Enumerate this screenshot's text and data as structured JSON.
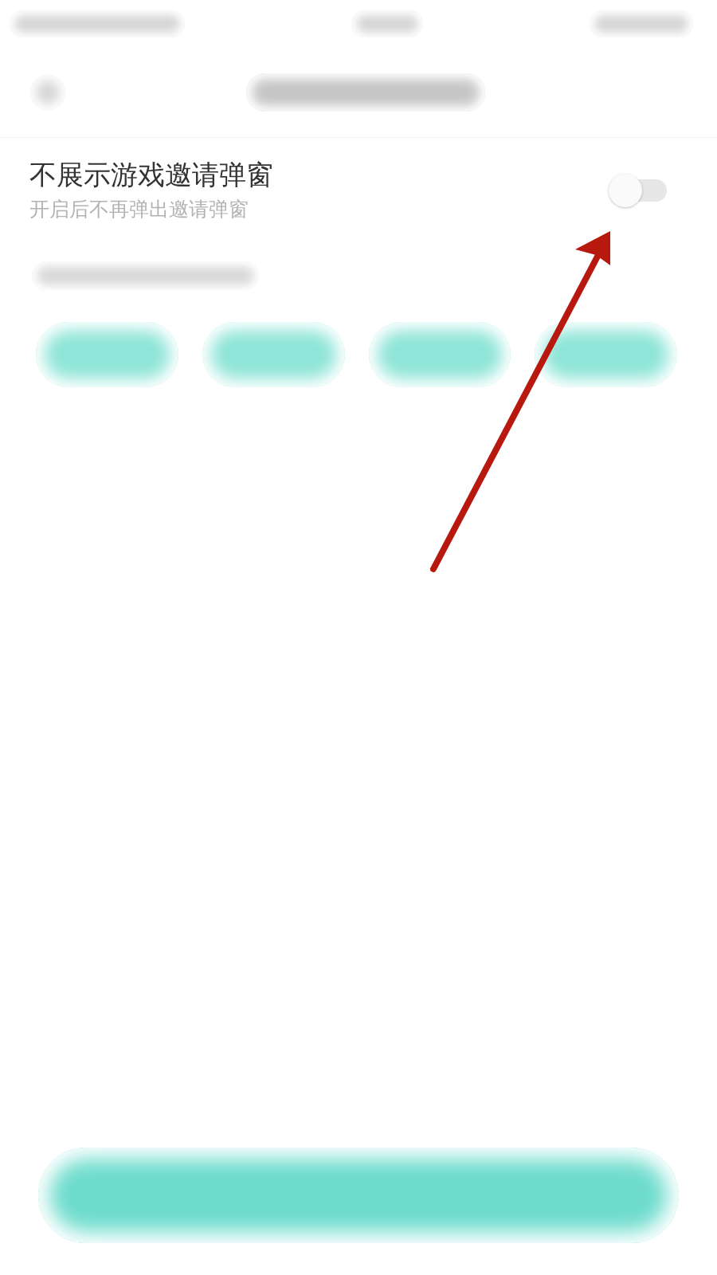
{
  "settings": [
    {
      "title": "不展示游戏邀请弹窗",
      "subtitle": "开启后不再弹出邀请弹窗",
      "on": false
    }
  ]
}
